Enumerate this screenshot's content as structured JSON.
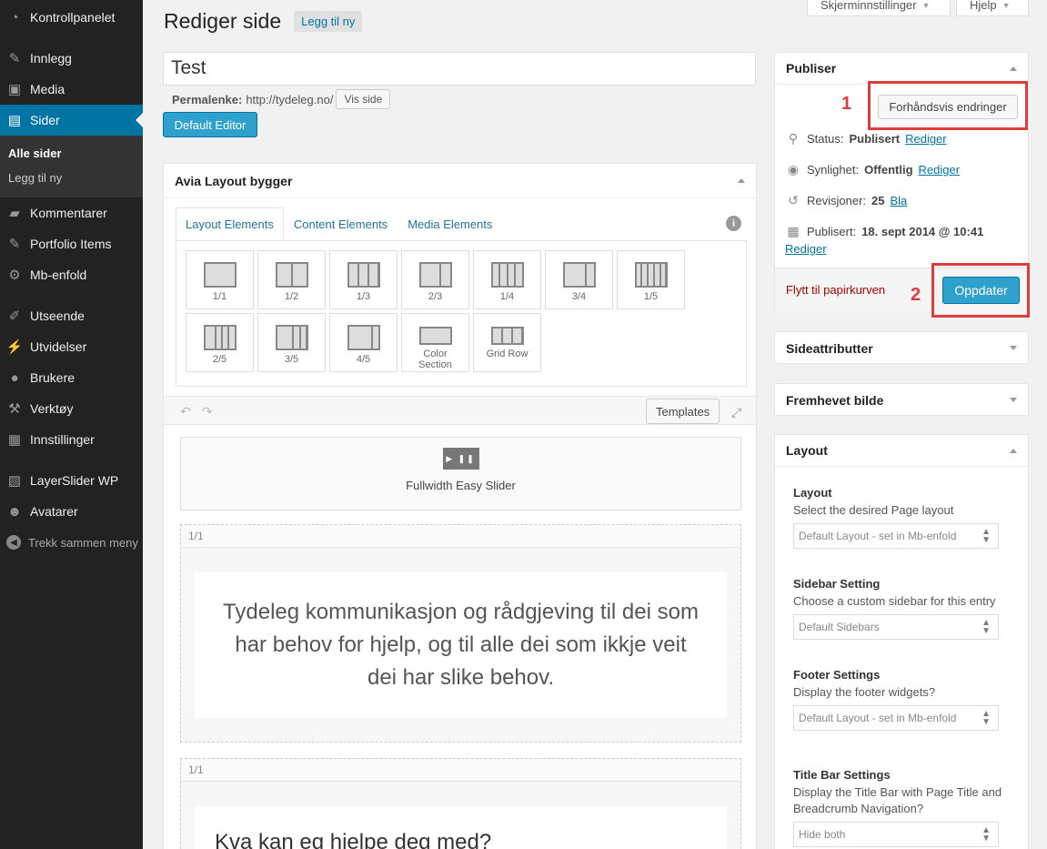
{
  "sidebar": {
    "items_top": [
      {
        "label": "Kontrollpanelet",
        "icon": "dashboard-icon"
      }
    ],
    "items_content": [
      {
        "label": "Innlegg",
        "icon": "pin-icon"
      },
      {
        "label": "Media",
        "icon": "media-icon"
      },
      {
        "label": "Sider",
        "icon": "page-icon"
      }
    ],
    "submenu": [
      "Alle sider",
      "Legg til ny"
    ],
    "items_after": [
      {
        "label": "Kommentarer",
        "icon": "comment-icon"
      },
      {
        "label": "Portfolio Items",
        "icon": "pin-icon"
      },
      {
        "label": "Mb-enfold",
        "icon": "gear-icon"
      }
    ],
    "items_admin": [
      {
        "label": "Utseende",
        "icon": "brush-icon"
      },
      {
        "label": "Utvidelser",
        "icon": "plugin-icon"
      },
      {
        "label": "Brukere",
        "icon": "user-icon"
      },
      {
        "label": "Verktøy",
        "icon": "wrench-icon"
      },
      {
        "label": "Innstillinger",
        "icon": "settings-icon"
      }
    ],
    "items_extra": [
      {
        "label": "LayerSlider WP",
        "icon": "layers-icon"
      },
      {
        "label": "Avatarer",
        "icon": "avatar-icon"
      }
    ],
    "collapse": "Trekk sammen meny"
  },
  "top": {
    "screen_options": "Skjerminnstillinger",
    "help": "Hjelp"
  },
  "page": {
    "title": "Rediger side",
    "add_new": "Legg til ny",
    "post_title": "Test",
    "permalink_label": "Permalenke:",
    "permalink_url": "http://tydeleg.no/",
    "view_page": "Vis side",
    "default_editor": "Default Editor"
  },
  "avia": {
    "title": "Avia Layout bygger",
    "tabs": [
      "Layout Elements",
      "Content Elements",
      "Media Elements"
    ],
    "elements": [
      "1/1",
      "1/2",
      "1/3",
      "2/3",
      "1/4",
      "3/4",
      "1/5",
      "2/5",
      "3/5",
      "4/5",
      "Color",
      "Section",
      "Grid Row"
    ],
    "templates": "Templates",
    "slider_label": "Fullwidth Easy Slider",
    "slider_icon_text": "▶ ❚❚",
    "col1_label": "1/1",
    "col1_text": "Tydeleg kommunikasjon og rådgjeving til dei som har behov for hjelp, og til alle dei som ikkje veit dei har slike behov.",
    "col2_label": "1/1",
    "col2_text": "Kva kan eg hjelpe deg med?"
  },
  "publish": {
    "title": "Publiser",
    "preview": "Forhåndsvis endringer",
    "status_label": "Status:",
    "status_value": "Publisert",
    "visibility_label": "Synlighet:",
    "visibility_value": "Offentlig",
    "revisions_label": "Revisjoner:",
    "revisions_value": "25",
    "revisions_link": "Bla",
    "published_label": "Publisert:",
    "published_value": "18. sept 2014 @ 10:41",
    "edit_link": "Rediger",
    "trash": "Flytt til papirkurven",
    "update": "Oppdater",
    "annot1": "1",
    "annot2": "2",
    "accent": "#2ea2cc",
    "annot_color": "#e03c3c"
  },
  "boxes": {
    "attributes": "Sideattributter",
    "featured": "Fremhevet bilde",
    "layout": "Layout"
  },
  "layout_box": {
    "layout_title": "Layout",
    "layout_desc": "Select the desired Page layout",
    "layout_value": "Default Layout - set in Mb-enfold",
    "sidebar_title": "Sidebar Setting",
    "sidebar_desc": "Choose a custom sidebar for this entry",
    "sidebar_value": "Default Sidebars",
    "footer_title": "Footer Settings",
    "footer_desc": "Display the footer widgets?",
    "footer_value": "Default Layout - set in Mb-enfold",
    "titlebar_title": "Title Bar Settings",
    "titlebar_desc": "Display the Title Bar with Page Title and Breadcrumb Navigation?",
    "titlebar_value": "Hide both"
  }
}
